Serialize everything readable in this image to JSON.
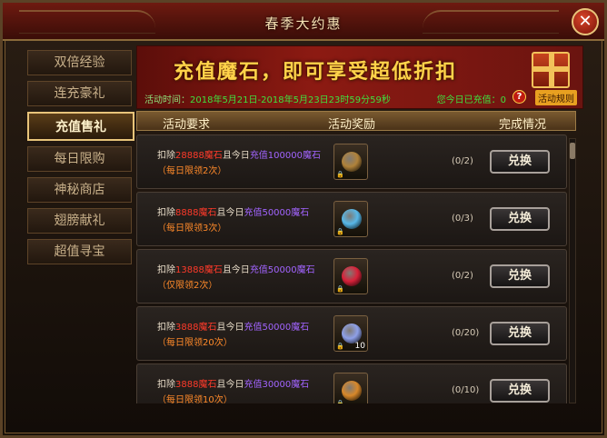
{
  "window": {
    "title": "春季大约惠"
  },
  "sidebar": {
    "items": [
      {
        "label": "双倍经验",
        "active": false
      },
      {
        "label": "连充豪礼",
        "active": false
      },
      {
        "label": "充值售礼",
        "active": true
      },
      {
        "label": "每日限购",
        "active": false
      },
      {
        "label": "神秘商店",
        "active": false
      },
      {
        "label": "翅膀献礼",
        "active": false
      },
      {
        "label": "超值寻宝",
        "active": false
      }
    ]
  },
  "banner": {
    "title": "充值魔石，即可享受超低折扣",
    "time_label": "活动时间：",
    "time_value": "2018年5月21日-2018年5月23日23时59分59秒",
    "recharged_text": "您今日已充值：0",
    "help_icon": "question-icon",
    "rules_label": "活动规则"
  },
  "table": {
    "headers": [
      "活动要求",
      "活动奖励",
      "完成情况"
    ],
    "button_label": "兑换",
    "rows": [
      {
        "deduct_prefix": "扣除",
        "deduct_amount": "28888魔石",
        "mid": "且今日",
        "recharge": "充值100000魔石",
        "limit": "（每日限领2次）",
        "item_icon": "compass-icon",
        "item_color": "#b0823a",
        "qty": "",
        "progress": "(0/2)"
      },
      {
        "deduct_prefix": "扣除",
        "deduct_amount": "8888魔石",
        "mid": "且今日",
        "recharge": "充值50000魔石",
        "limit": "（每日限领3次）",
        "item_icon": "crystal-icon",
        "item_color": "#58b8e8",
        "qty": "",
        "progress": "(0/3)"
      },
      {
        "deduct_prefix": "扣除",
        "deduct_amount": "13888魔石",
        "mid": "且今日",
        "recharge": "充值50000魔石",
        "limit": "（仅限领2次）",
        "item_icon": "red-orb-icon",
        "item_color": "#d8223a",
        "qty": "",
        "progress": "(0/2)"
      },
      {
        "deduct_prefix": "扣除",
        "deduct_amount": "3888魔石",
        "mid": "且今日",
        "recharge": "充值50000魔石",
        "limit": "（每日限领20次）",
        "item_icon": "gift-box-icon",
        "item_color": "#8ea0e8",
        "qty": "10",
        "progress": "(0/20)"
      },
      {
        "deduct_prefix": "扣除",
        "deduct_amount": "3888魔石",
        "mid": "且今日",
        "recharge": "充值30000魔石",
        "limit": "（每日限领10次）",
        "item_icon": "coin-icon",
        "item_color": "#d8882a",
        "qty": "",
        "progress": "(0/10)"
      }
    ]
  },
  "colors": {
    "accent_gold": "#e8c47a",
    "banner_red": "#8c1a12",
    "green_text": "#3fe03f"
  }
}
